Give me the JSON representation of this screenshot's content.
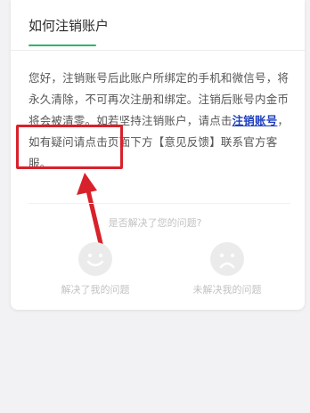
{
  "page": {
    "title": "如何注销账户"
  },
  "article": {
    "text_before_link": "您好，注销账号后此账户所绑定的手机和微信号，将永久清除，不可再次注册和绑定。注销后账号内金币将会被清零。如若坚持注销账户，请点击",
    "link_text": "注销账号",
    "text_after_link": "，如有疑问请点击页面下方【意见反馈】联系官方客服。"
  },
  "feedback": {
    "question": "是否解决了您的问题?",
    "solved_label": "解决了我的问题",
    "unsolved_label": "未解决我的问题"
  },
  "colors": {
    "accent": "#2db56b",
    "link": "#1f3fbf",
    "annotation_red": "#d8212b"
  }
}
